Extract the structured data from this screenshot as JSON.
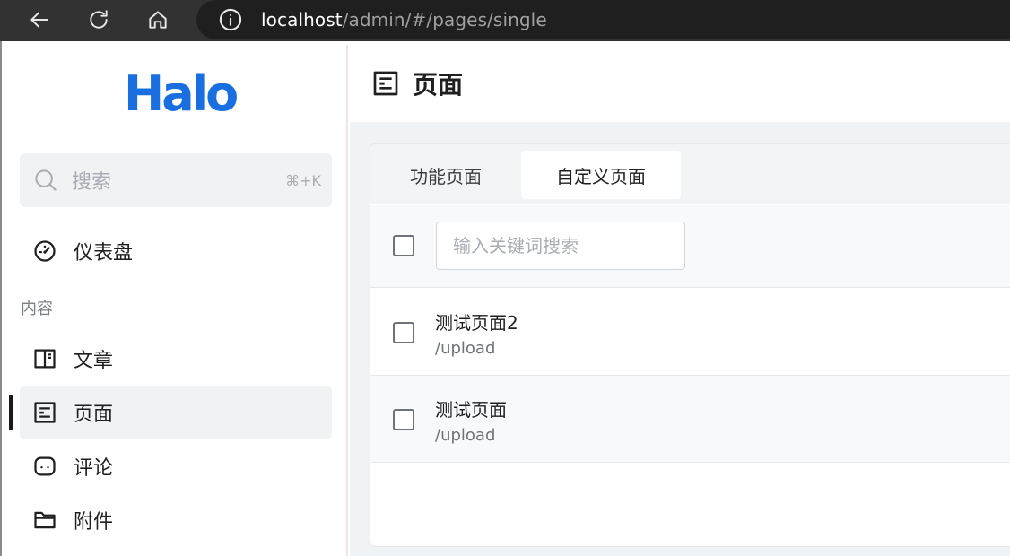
{
  "browser": {
    "url_host": "localhost",
    "url_path": "/admin/#/pages/single",
    "icons": [
      "back-icon",
      "reload-icon",
      "home-icon",
      "info-icon"
    ]
  },
  "sidebar": {
    "logo": "Halo",
    "search": {
      "label": "搜索",
      "shortcut": "⌘+K"
    },
    "dashboard": {
      "label": "仪表盘",
      "icon": "dashboard-icon"
    },
    "group_content": "内容",
    "items": [
      {
        "label": "文章",
        "icon": "book-icon"
      },
      {
        "label": "页面",
        "icon": "page-icon",
        "active": true
      },
      {
        "label": "评论",
        "icon": "comment-icon"
      },
      {
        "label": "附件",
        "icon": "folder-icon"
      }
    ]
  },
  "header": {
    "title": "页面",
    "icon": "page-icon"
  },
  "tabs": [
    {
      "label": "功能页面",
      "active": false
    },
    {
      "label": "自定义页面",
      "active": true
    }
  ],
  "toolbar": {
    "search_placeholder": "输入关键词搜索"
  },
  "rows": [
    {
      "title": "测试页面2",
      "path": "/upload"
    },
    {
      "title": "测试页面",
      "path": "/upload"
    }
  ],
  "colors": {
    "brand": "#1a6fe0",
    "sidebar_active_bg": "#f1f2f4",
    "main_bg": "#f0f3f6"
  }
}
